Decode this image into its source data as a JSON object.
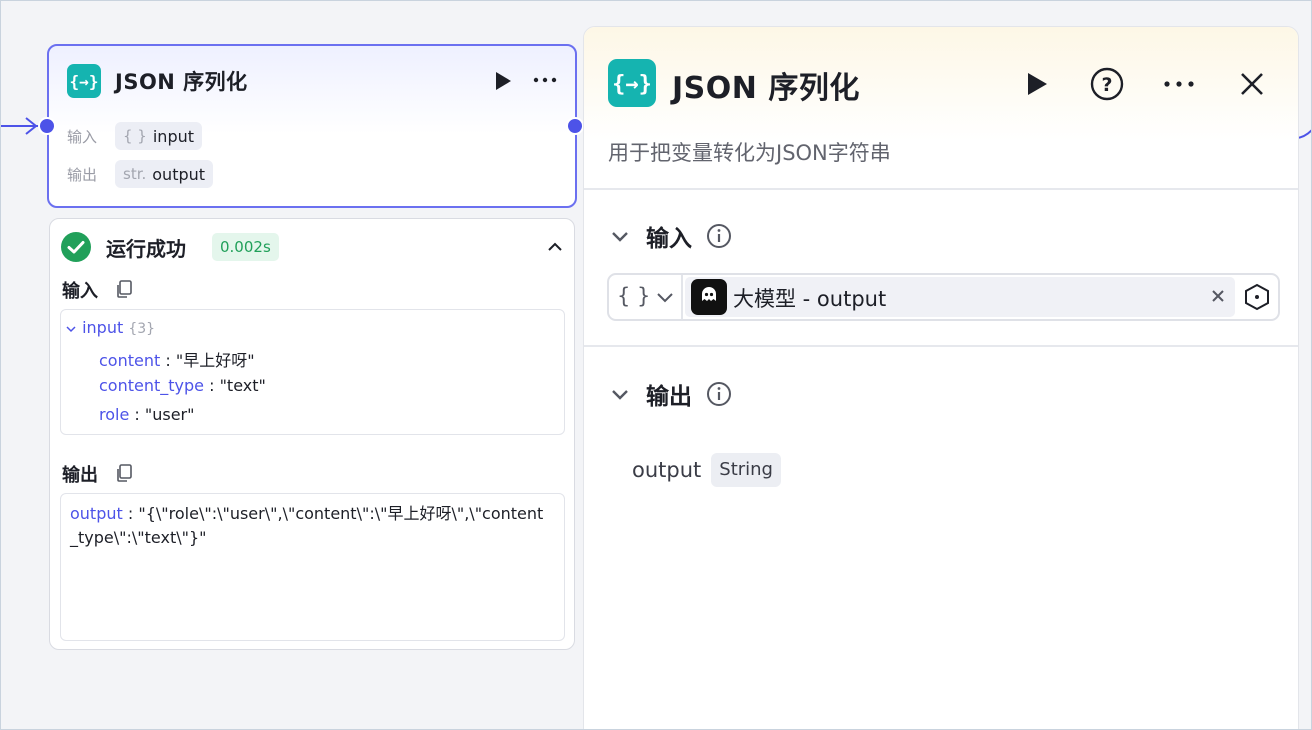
{
  "node": {
    "title": "JSON 序列化",
    "input_label": "输入",
    "input_type": "{ }",
    "input_name": "input",
    "output_label": "输出",
    "output_type": "str.",
    "output_name": "output"
  },
  "run": {
    "status": "运行成功",
    "duration": "0.002s",
    "input_label": "输入",
    "input_root_key": "input",
    "input_count": "{3}",
    "input_fields": [
      {
        "key": "content",
        "value": "\"早上好呀\""
      },
      {
        "key": "content_type",
        "value": "\"text\""
      },
      {
        "key": "role",
        "value": "\"user\""
      }
    ],
    "output_label": "输出",
    "output_key": "output",
    "output_value": "\"{\\\"role\\\":\\\"user\\\",\\\"content\\\":\\\"早上好呀\\\",\\\"content_type\\\":\\\"text\\\"}\""
  },
  "panel": {
    "title": "JSON 序列化",
    "description": "用于把变量转化为JSON字符串",
    "input_section": "输入",
    "input_type": "{ }",
    "input_ref": "大模型 - output",
    "output_section": "输出",
    "output_name": "output",
    "output_type": "String"
  },
  "colors": {
    "accent": "#4d53e8",
    "node_icon": "#15b4b0",
    "success": "#21a05a"
  }
}
